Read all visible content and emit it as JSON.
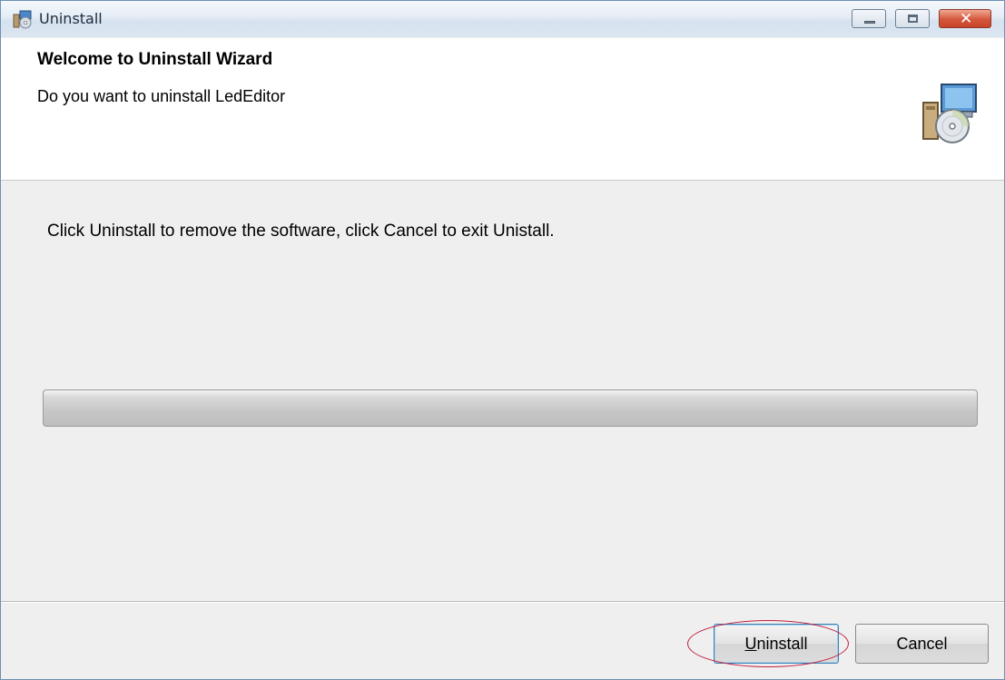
{
  "window": {
    "title": "Uninstall",
    "icon": "installer-icon",
    "controls": {
      "minimize_icon": "minimize-icon",
      "maximize_icon": "maximize-icon",
      "close_icon": "close-icon",
      "close_glyph": "✕"
    }
  },
  "header": {
    "title": "Welcome to Uninstall Wizard",
    "subtitle": "Do you want to uninstall LedEditor",
    "icon": "installer-disc-icon"
  },
  "body": {
    "message": "Click Uninstall to remove the software, click Cancel to exit Unistall.",
    "progress": 0
  },
  "footer": {
    "uninstall_label_accel": "U",
    "uninstall_label_rest": "ninstall",
    "cancel_label": "Cancel"
  },
  "colors": {
    "close_button": "#d4563c",
    "highlight_ellipse": "#c21e3c",
    "default_button_border": "#3c7fb1"
  }
}
